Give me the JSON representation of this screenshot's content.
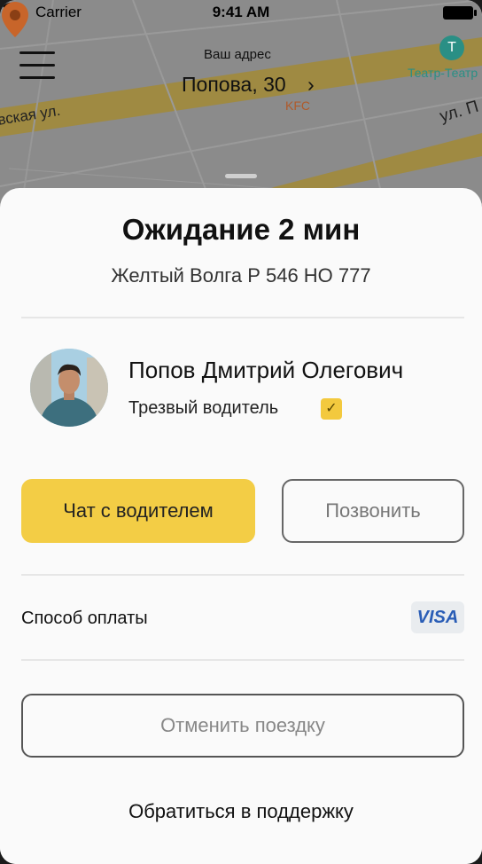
{
  "status_bar": {
    "carrier": "Carrier",
    "time": "9:41 AM"
  },
  "map": {
    "address_label": "Ваш адрес",
    "address_value": "Попова, 30",
    "address_chevron": "›",
    "poi_kfc": "KFC",
    "poi_theatre": "Театр-Театр",
    "theatre_icon_glyph": "Т",
    "street_left": "вская ул.",
    "street_right": "ул. П"
  },
  "trip": {
    "title": "Ожидание 2 мин",
    "car": "Желтый Волга Р 546 НО 777"
  },
  "driver": {
    "name": "Попов Дмитрий Олегович",
    "tag": "Трезвый водитель",
    "tag_checked": true
  },
  "actions": {
    "chat_label": "Чат с водителем",
    "call_label": "Позвонить",
    "cancel_label": "Отменить поездку",
    "support_label": "Обратиться в поддержку"
  },
  "payment": {
    "label": "Способ оплаты",
    "method": "VISA"
  },
  "colors": {
    "accent_yellow": "#F3CD45",
    "visa_blue": "#2A5DB6",
    "theatre_green": "#2A8F85",
    "map_overlay": "#8B8B8B"
  }
}
